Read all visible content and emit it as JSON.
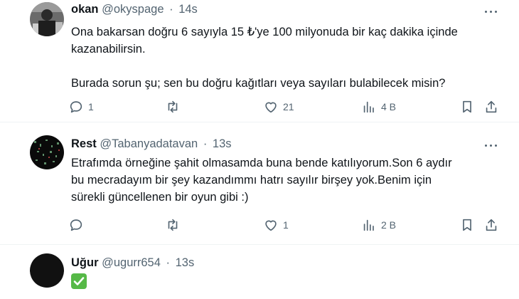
{
  "tweets": [
    {
      "name": "okan",
      "handle": "@okyspage",
      "separator": "·",
      "time": "14s",
      "lines": [
        "Ona bakarsan doğru 6 sayıyla 15 ₺'ye 100 milyonuda bir kaç dakika içinde",
        "kazanabilirsin.",
        "",
        "Burada sorun şu; sen bu doğru kağıtları veya sayıları bulabilecek misin?"
      ],
      "replies": "1",
      "retweets": "",
      "likes": "21",
      "views": "4 B"
    },
    {
      "name": "Rest",
      "handle": "@Tabanyadatavan",
      "separator": "·",
      "time": "13s",
      "lines": [
        "Etrafımda örneğine şahit olmasamda buna bende katılıyorum.Son 6 aydır",
        "bu mecradayım bir şey kazandımmı hatrı sayılır birşey yok.Benim için",
        "sürekli güncellenen bir oyun gibi :)"
      ],
      "replies": "",
      "retweets": "",
      "likes": "1",
      "views": "2 B"
    },
    {
      "name": "Uğur",
      "handle": "@ugurr654",
      "separator": "·",
      "time": "13s",
      "emoji": "check-mark-button"
    }
  ],
  "colors": {
    "text": "#0f1419",
    "muted": "#536471",
    "divider": "#eff3f4",
    "emoji_green": "#56b947"
  }
}
